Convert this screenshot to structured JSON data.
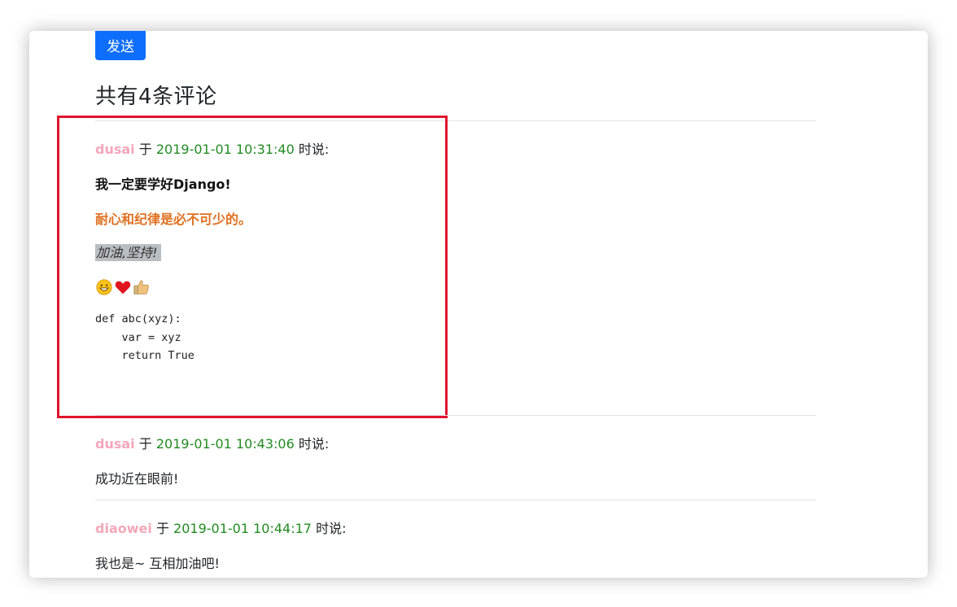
{
  "form": {
    "send_label": "发送"
  },
  "comments_title": "共有4条评论",
  "comments": [
    {
      "user": "dusai",
      "connector": "于",
      "time": "2019-01-01 10:31:40",
      "said": "时说:",
      "lines": [
        "我一定要学好Django!",
        "耐心和纪律是必不可少的。",
        "加油,坚持!"
      ],
      "emojis": [
        "grinning-face-icon",
        "red-heart-icon",
        "thumbs-up-icon"
      ],
      "code": "def abc(xyz):\n    var = xyz\n    return True"
    },
    {
      "user": "dusai",
      "connector": "于",
      "time": "2019-01-01 10:43:06",
      "said": "时说:",
      "text": "成功近在眼前!"
    },
    {
      "user": "diaowei",
      "connector": "于",
      "time": "2019-01-01 10:44:17",
      "said": "时说:",
      "text": "我也是~ 互相加油吧!"
    }
  ],
  "colors": {
    "accent": "#0d6efd",
    "username": "#f4a7b9",
    "timestamp": "#228b22",
    "orange_text": "#e07020",
    "annotation_box": "#e0142c"
  }
}
